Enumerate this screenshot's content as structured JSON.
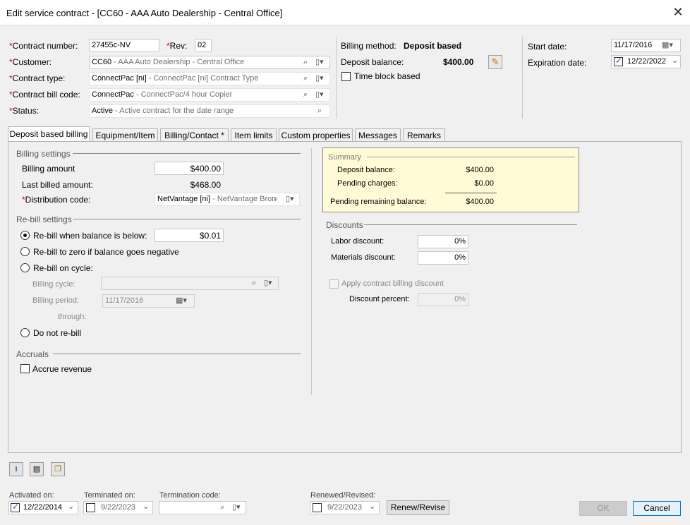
{
  "window": {
    "title": "Edit service contract - [CC60 - AAA Auto Dealership - Central Office]",
    "close_glyph": "✕"
  },
  "header": {
    "contract_number_label": "Contract number:",
    "contract_number_value": "27455c-NV",
    "rev_label": "Rev:",
    "rev_value": "02",
    "customer_label": "Customer:",
    "customer_code": "CC60",
    "customer_desc": " - AAA Auto Dealership - Central Office",
    "contract_type_label": "Contract type:",
    "contract_type_code": "ConnectPac [ni]",
    "contract_type_desc": " - ConnectPac [ni] Contract Type",
    "bill_code_label": "Contract bill code:",
    "bill_code_code": "ConnectPac",
    "bill_code_desc": " - ConnectPac/4 hour Copier",
    "status_label": "Status:",
    "status_code": "Active",
    "status_desc": " - Active contract for the date range",
    "required_marker": "*",
    "billing_method_label": "Billing method:",
    "billing_method_value": "Deposit based",
    "deposit_balance_label": "Deposit balance:",
    "deposit_balance_value": "$400.00",
    "time_block_label": "Time block based",
    "start_date_label": "Start date:",
    "start_date_value": "11/17/2016",
    "expiration_date_label": "Expiration date:",
    "expiration_date_value": "12/22/2022"
  },
  "tabs": [
    {
      "label": "Deposit based billing"
    },
    {
      "label": "Equipment/Item"
    },
    {
      "label": "Billing/Contact *"
    },
    {
      "label": "Item limits"
    },
    {
      "label": "Custom properties"
    },
    {
      "label": "Messages"
    },
    {
      "label": "Remarks"
    }
  ],
  "billing_settings": {
    "group_label": "Billing settings",
    "billing_amount_label": "Billing amount",
    "billing_amount_value": "$400.00",
    "last_billed_label": "Last billed amount:",
    "last_billed_value": "$468.00",
    "distribution_label": "Distribution code:",
    "distribution_code": "NetVantage [ni]",
    "distribution_desc": " - NetVantage Bron"
  },
  "rebill": {
    "group_label": "Re-bill settings",
    "opt_below_label": "Re-bill when balance is below:",
    "opt_below_value": "$0.01",
    "opt_zero_label": "Re-bill to zero if balance goes negative",
    "opt_cycle_label": "Re-bill on cycle:",
    "billing_cycle_label": "Billing cycle:",
    "billing_period_label": "Billing period:",
    "billing_period_value": "11/17/2016",
    "through_label": "through:",
    "opt_none_label": "Do not re-bill"
  },
  "accruals": {
    "group_label": "Accruals",
    "accrue_label": "Accrue revenue"
  },
  "summary": {
    "group_label": "Summary",
    "deposit_balance_label": "Deposit balance:",
    "deposit_balance_value": "$400.00",
    "pending_charges_label": "Pending charges:",
    "pending_charges_value": "$0.00",
    "remaining_label": "Pending remaining balance:",
    "remaining_value": "$400.00"
  },
  "discounts": {
    "group_label": "Discounts",
    "labor_label": "Labor discount:",
    "labor_value": "0%",
    "materials_label": "Materials discount:",
    "materials_value": "0%",
    "apply_label": "Apply contract billing discount",
    "percent_label": "Discount percent:",
    "percent_value": "0%"
  },
  "footer": {
    "activated_label": "Activated on:",
    "activated_value": "12/22/2014",
    "terminated_label": "Terminated on:",
    "terminated_value": "9/22/2023",
    "termination_code_label": "Termination code:",
    "renewed_label": "Renewed/Revised:",
    "renewed_value": "9/22/2023",
    "renew_button": "Renew/Revise",
    "ok_button": "OK",
    "cancel_button": "Cancel"
  },
  "icons": {
    "search": "⌕",
    "lookup": "▯▾",
    "calendar": "▦▾",
    "chevron": "⌄",
    "edit": "✎",
    "info": "i",
    "notes": "▤",
    "copy": "❐"
  },
  "colors": {
    "summary_bg": "#fffbd6",
    "required": "#d00000",
    "accent": "#0078d7"
  }
}
